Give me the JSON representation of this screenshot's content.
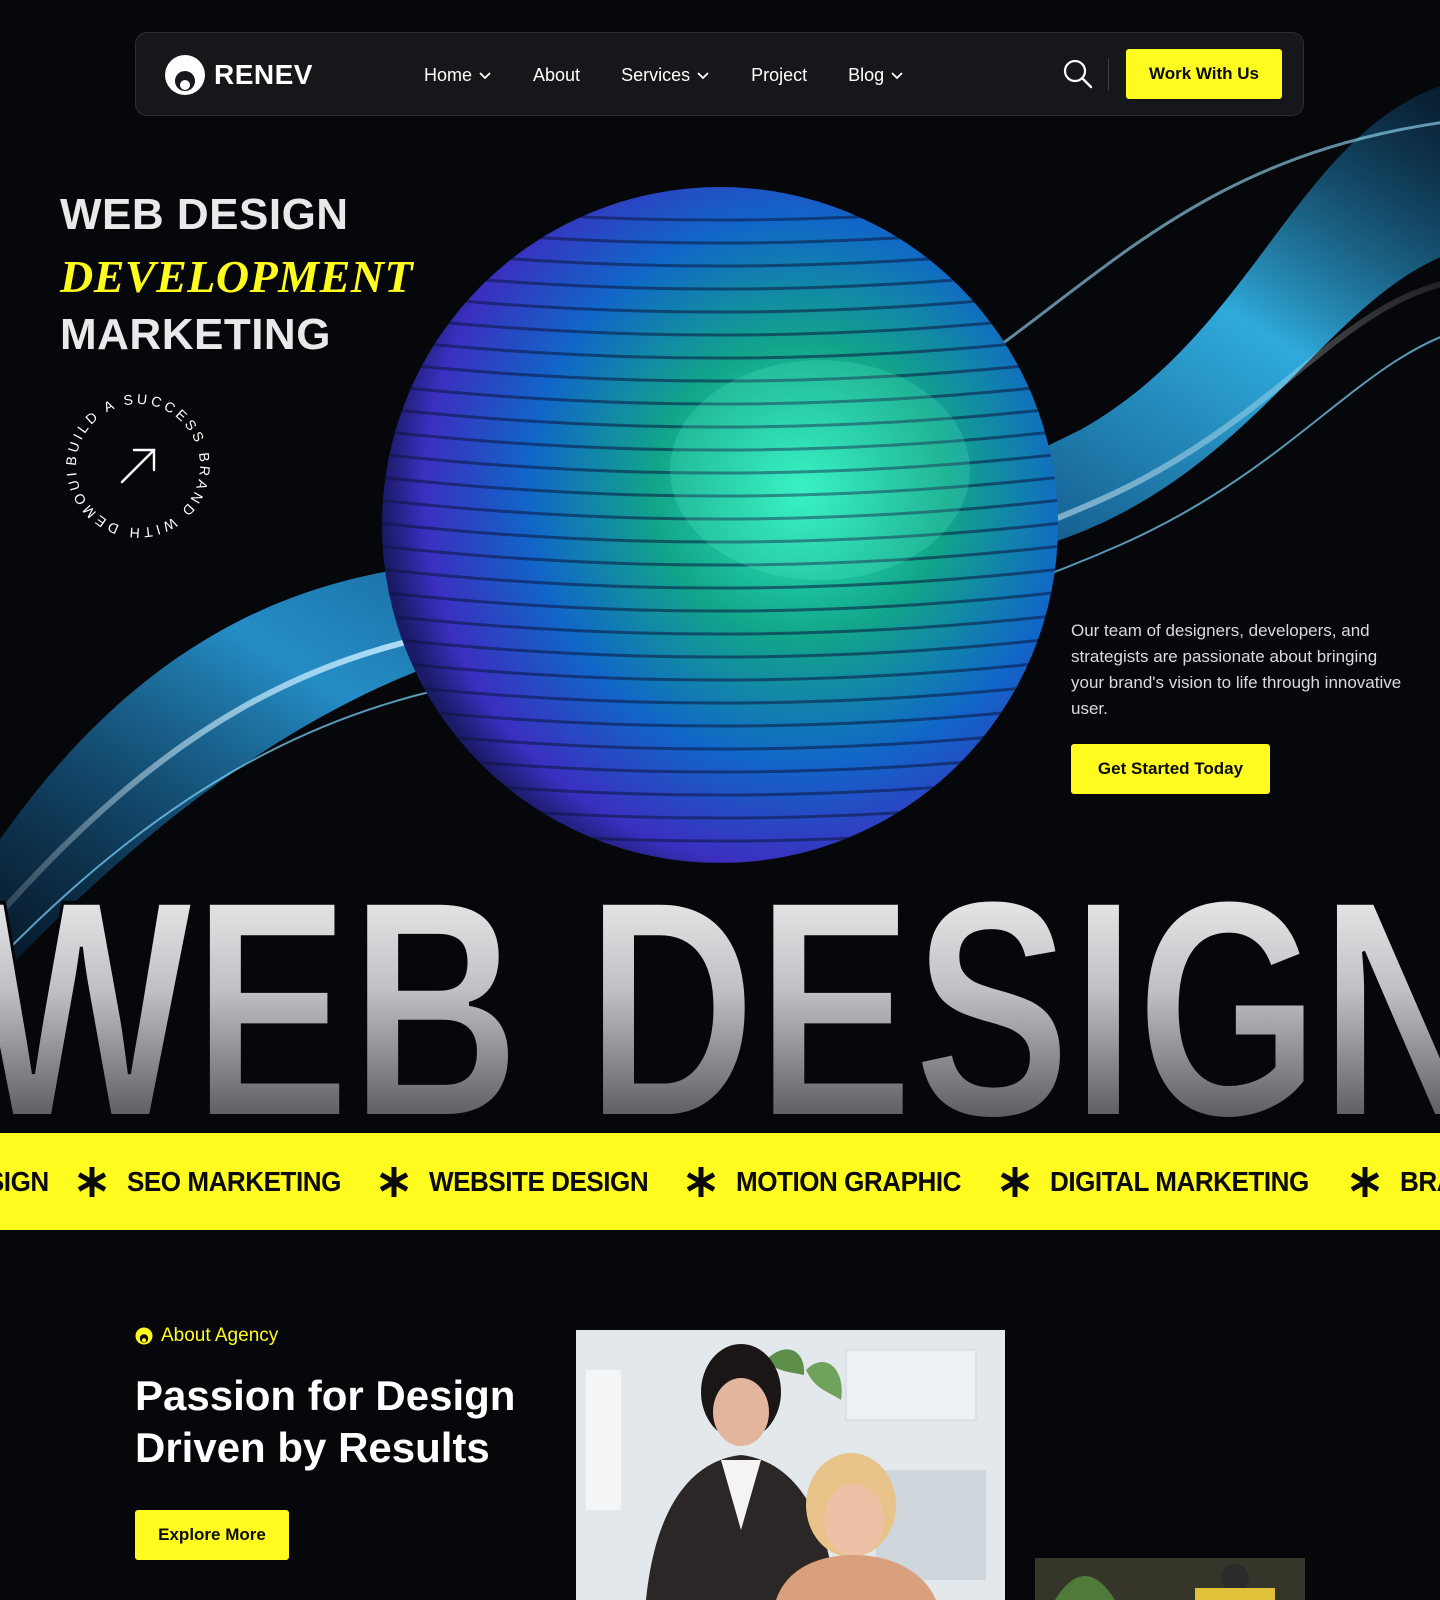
{
  "header": {
    "logo_text": "RENEV",
    "nav": [
      {
        "label": "Home",
        "has_dropdown": true
      },
      {
        "label": "About",
        "has_dropdown": false
      },
      {
        "label": "Services",
        "has_dropdown": true
      },
      {
        "label": "Project",
        "has_dropdown": false
      },
      {
        "label": "Blog",
        "has_dropdown": true
      }
    ],
    "cta_label": "Work With Us"
  },
  "hero": {
    "line1": "WEB DESIGN",
    "line2": "DEVELOPMENT",
    "line3": "MARKETING",
    "badge_text": "BUILD A SUCCESS BRAND WITH DEMOUI",
    "description": "Our team of designers, developers, and strategists are passionate about bringing your brand's vision to life through innovative user.",
    "cta_label": "Get Started Today",
    "giant_text": "WEB DESIGN"
  },
  "marquee": {
    "items": [
      "ESIGN",
      "SEO MARKETING",
      "WEBSITE DESIGN",
      "MOTION GRAPHIC",
      "DIGITAL MARKETING",
      "BRANDING"
    ]
  },
  "about": {
    "tag": "About Agency",
    "title": "Passion for Design Driven by Results",
    "cta_label": "Explore More"
  },
  "colors": {
    "accent": "#fffb1f",
    "background": "#05070b",
    "header_bg": "#15171b"
  },
  "icons": {
    "search": "search-icon",
    "arrow": "arrow-up-right-icon",
    "star": "asterisk-icon",
    "chevron": "chevron-down-icon"
  }
}
